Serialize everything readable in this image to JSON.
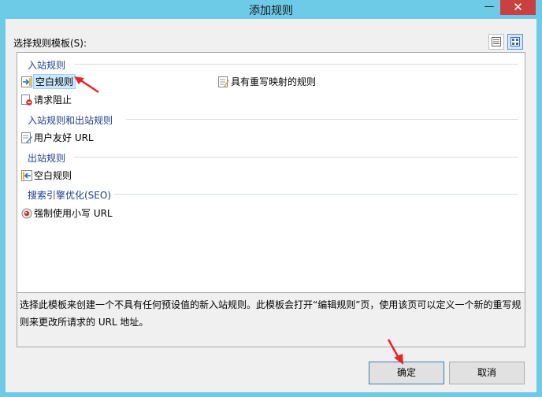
{
  "window": {
    "title": "添加规则",
    "minimize_glyph": "—",
    "close_glyph": "✕"
  },
  "select_label": "选择规则模板(S):",
  "groups": [
    {
      "label": "入站规则"
    },
    {
      "label": "入站规则和出站规则"
    },
    {
      "label": "出站规则"
    },
    {
      "label": "搜索引擎优化(SEO)"
    }
  ],
  "items": {
    "blank_inbound": {
      "label": "空白规则",
      "icon": "inbound-rule-icon",
      "selected": true
    },
    "rewrite_map": {
      "label": "具有重写映射的规则",
      "icon": "rewrite-map-icon"
    },
    "request_block": {
      "label": "请求阻止",
      "icon": "block-icon"
    },
    "friendly_url": {
      "label": "用户友好 URL",
      "icon": "friendly-url-icon"
    },
    "blank_outbound": {
      "label": "空白规则",
      "icon": "outbound-rule-icon"
    },
    "lowercase_url": {
      "label": "强制使用小写 URL",
      "icon": "seo-icon"
    }
  },
  "description": "选择此模板来创建一个不具有任何预设值的新入站规则。此模板会打开“编辑规则”页，使用该页可以定义一个新的重写规则来更改所请求的 URL 地址。",
  "buttons": {
    "ok": "确定",
    "cancel": "取消"
  },
  "colors": {
    "title_bar": "#6ecbe8",
    "group_header": "#1e3f8c",
    "selection": "#cce8ff",
    "close_button": "#c94040",
    "annotation_arrow": "#e8232a"
  }
}
